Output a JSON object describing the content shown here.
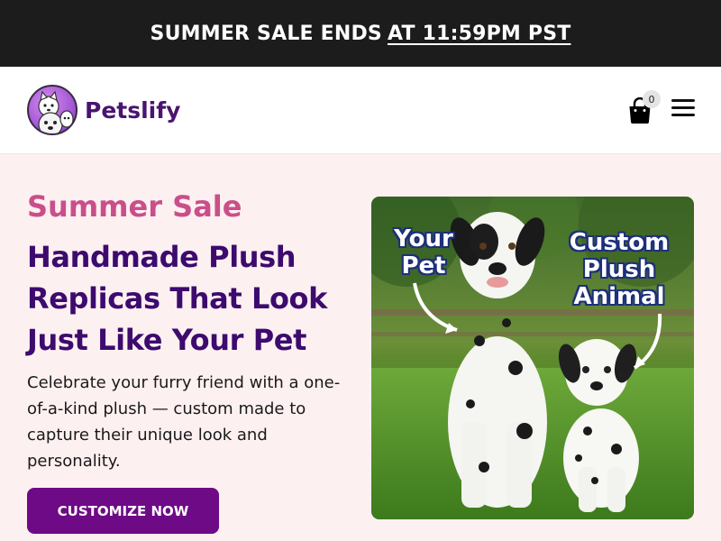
{
  "announcement": {
    "prefix": "SUMMER SALE ENDS",
    "time": "AT 11:59PM PST"
  },
  "header": {
    "brand": "Petslify",
    "cart_count": "0"
  },
  "hero": {
    "kicker": "Summer Sale",
    "title": "Handmade Plush Replicas That Look Just Like Your Pet",
    "description": "Celebrate your furry friend with a one-of-a-kind plush — custom made to capture their unique look and personality.",
    "cta_label": "CUSTOMIZE NOW",
    "image": {
      "label_pet": "Your Pet",
      "label_plush": "Custom Plush Animal"
    }
  },
  "colors": {
    "announcement_bg": "#1c1c1c",
    "page_bg": "#fdf0f1",
    "brand_purple": "#4a1470",
    "kicker_pink": "#c94f8a",
    "title_purple": "#3d0a6e",
    "cta_bg": "#6e0a86"
  },
  "icons": {
    "logo": "pets-logo-icon",
    "cart": "shopping-bag-icon",
    "menu": "hamburger-menu-icon"
  }
}
